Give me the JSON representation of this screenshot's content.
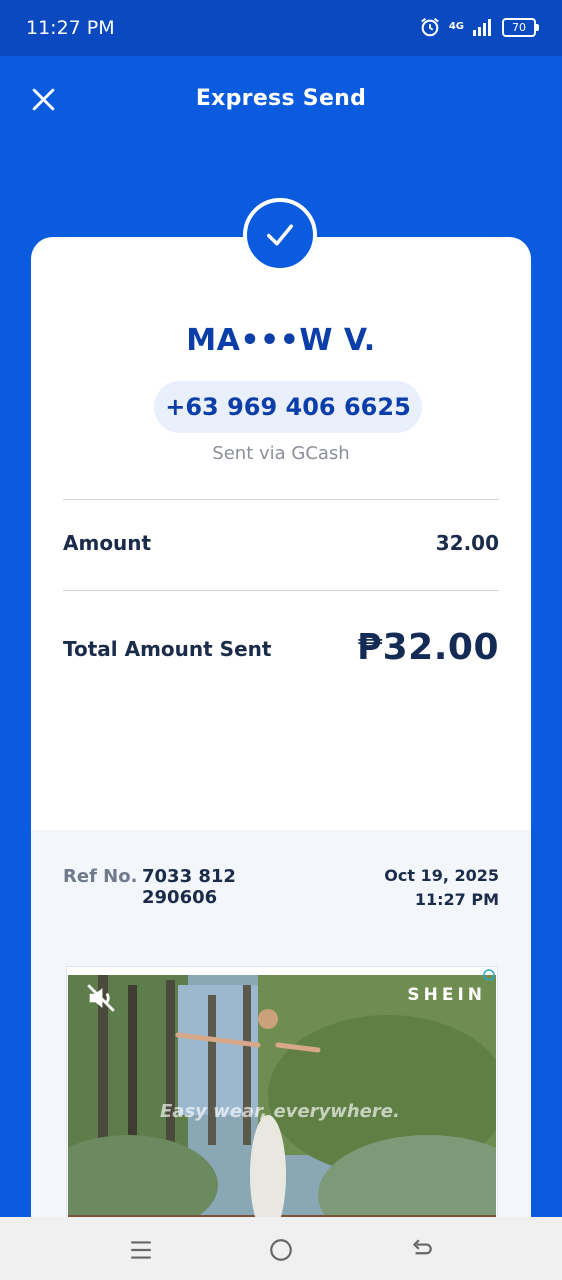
{
  "status_bar": {
    "time": "11:27 PM",
    "network_label": "4G",
    "battery_level": "70",
    "icons": [
      "alarm-icon",
      "signal-icon",
      "battery-icon"
    ]
  },
  "header": {
    "title": "Express Send",
    "close_icon": "close-icon"
  },
  "receipt": {
    "status_icon": "check-icon",
    "recipient_name": "MA•••W V.",
    "phone": "+63 969 406 6625",
    "sent_via": "Sent via GCash",
    "amount_label": "Amount",
    "amount_value": "32.00",
    "total_label": "Total Amount Sent",
    "total_value": "₱32.00",
    "ref_label": "Ref No.",
    "ref_number": "7033 812 290606",
    "date": "Oct 19, 2025 11:27 PM"
  },
  "ad": {
    "brand": "SHEIN",
    "caption": "Easy wear, everywhere.",
    "mute_icon": "mute-icon"
  },
  "nav_bar": {
    "icons": [
      "menu-icon",
      "home-icon",
      "back-icon"
    ]
  },
  "colors": {
    "primary": "#0a5bde",
    "status_bar": "#0a49c0",
    "brand_text": "#0b3ea8",
    "dark_text": "#1b2b4a"
  }
}
